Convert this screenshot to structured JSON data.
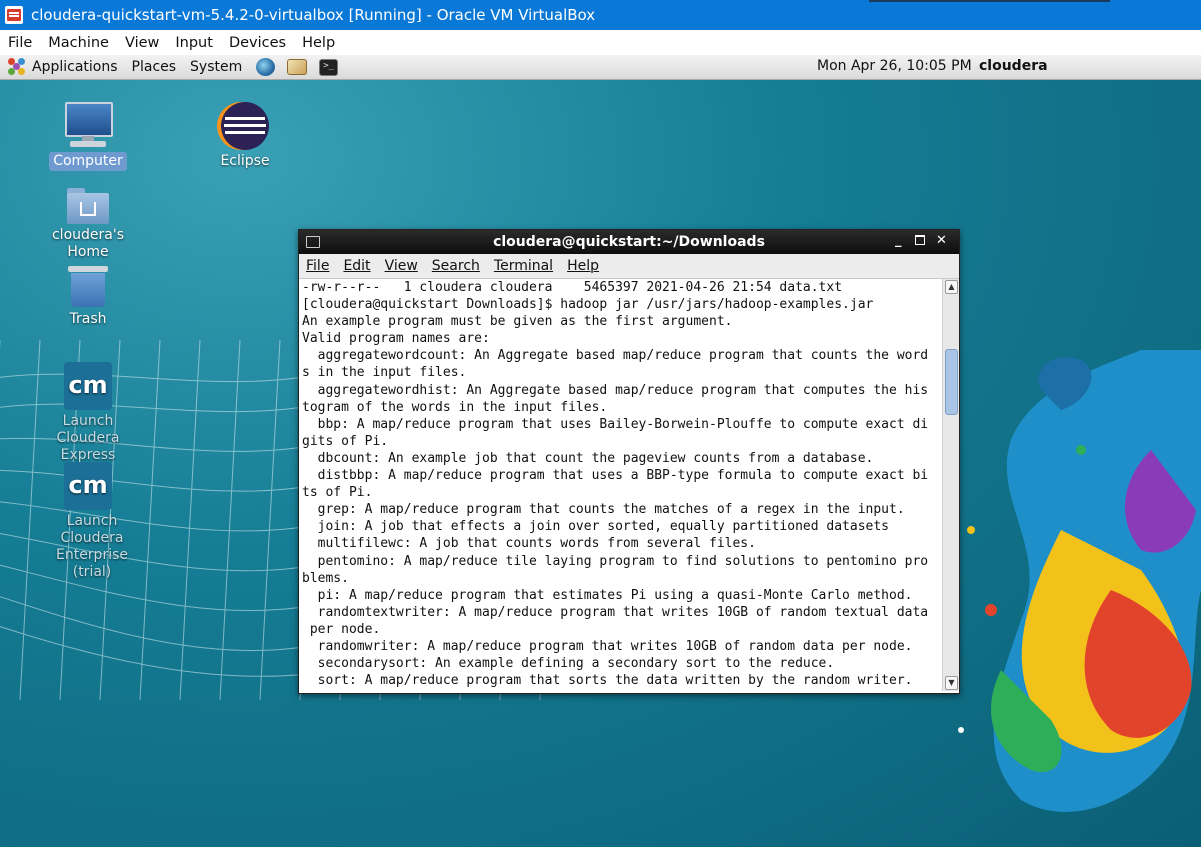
{
  "host_window": {
    "title": "cloudera-quickstart-vm-5.4.2-0-virtualbox [Running] - Oracle VM VirtualBox",
    "menu": [
      "File",
      "Machine",
      "View",
      "Input",
      "Devices",
      "Help"
    ]
  },
  "panel": {
    "menus": [
      "Applications",
      "Places",
      "System"
    ],
    "launchers": [
      "browser-icon",
      "mail-icon",
      "terminal-icon"
    ],
    "clock": "Mon Apr 26, 10:05 PM",
    "user": "cloudera"
  },
  "desktop_icons": [
    {
      "label": "Computer",
      "icon": "computer-icon"
    },
    {
      "label": "Eclipse",
      "icon": "eclipse-icon"
    },
    {
      "label": "cloudera's Home",
      "icon": "home-folder-icon"
    },
    {
      "label": "Trash",
      "icon": "trash-icon"
    },
    {
      "label": "Launch Cloudera Express",
      "icon": "cloudera-manager-icon"
    },
    {
      "label": "Launch Cloudera Enterprise (trial)",
      "icon": "cloudera-manager-icon"
    }
  ],
  "terminal": {
    "title": "cloudera@quickstart:~/Downloads",
    "menu": [
      "File",
      "Edit",
      "View",
      "Search",
      "Terminal",
      "Help"
    ],
    "lines": [
      "-rw-r--r--   1 cloudera cloudera    5465397 2021-04-26 21:54 data.txt",
      "[cloudera@quickstart Downloads]$ hadoop jar /usr/jars/hadoop-examples.jar",
      "An example program must be given as the first argument.",
      "Valid program names are:",
      "  aggregatewordcount: An Aggregate based map/reduce program that counts the word",
      "s in the input files.",
      "  aggregatewordhist: An Aggregate based map/reduce program that computes the his",
      "togram of the words in the input files.",
      "  bbp: A map/reduce program that uses Bailey-Borwein-Plouffe to compute exact di",
      "gits of Pi.",
      "  dbcount: An example job that count the pageview counts from a database.",
      "  distbbp: A map/reduce program that uses a BBP-type formula to compute exact bi",
      "ts of Pi.",
      "  grep: A map/reduce program that counts the matches of a regex in the input.",
      "  join: A job that effects a join over sorted, equally partitioned datasets",
      "  multifilewc: A job that counts words from several files.",
      "  pentomino: A map/reduce tile laying program to find solutions to pentomino pro",
      "blems.",
      "  pi: A map/reduce program that estimates Pi using a quasi-Monte Carlo method.",
      "  randomtextwriter: A map/reduce program that writes 10GB of random textual data",
      " per node.",
      "  randomwriter: A map/reduce program that writes 10GB of random data per node.",
      "  secondarysort: An example defining a secondary sort to the reduce.",
      "  sort: A map/reduce program that sorts the data written by the random writer."
    ]
  },
  "colors": {
    "host_titlebar": "#0a78d7",
    "desktop_bg": "#157d95",
    "terminal_titlebar": "#1a1a1a"
  }
}
